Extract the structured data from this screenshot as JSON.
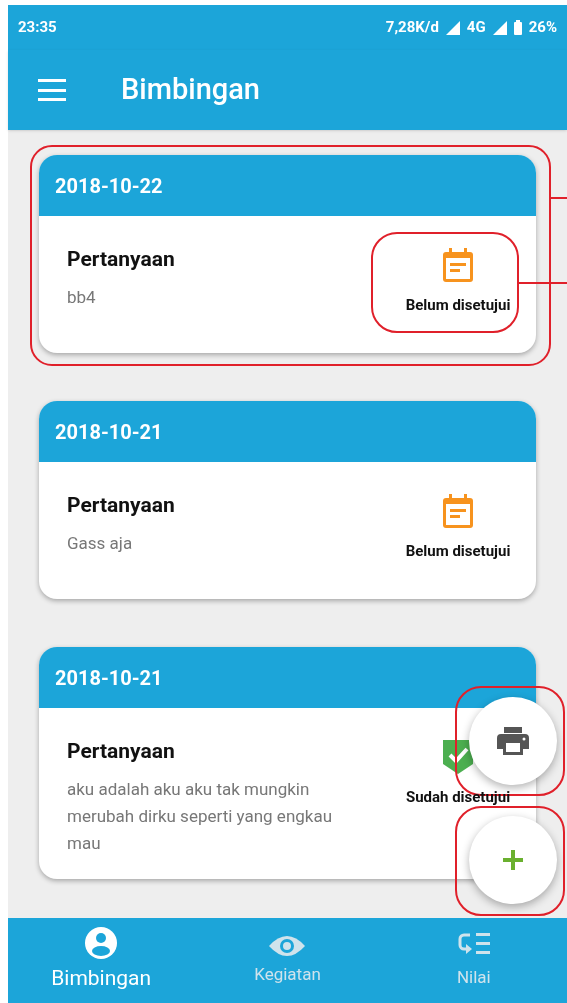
{
  "status_bar": {
    "time": "23:35",
    "speed": "7,28K/d",
    "network": "4G",
    "battery": "26%"
  },
  "app_bar": {
    "title": "Bimbingan"
  },
  "cards": [
    {
      "date": "2018-10-22",
      "title": "Pertanyaan",
      "text": "bb4",
      "status": {
        "kind": "pending",
        "label": "Belum disetujui"
      }
    },
    {
      "date": "2018-10-21",
      "title": "Pertanyaan",
      "text": "Gass aja",
      "status": {
        "kind": "pending",
        "label": "Belum disetujui"
      }
    },
    {
      "date": "2018-10-21",
      "title": "Pertanyaan",
      "text": "aku adalah aku aku tak mungkin merubah dirku seperti yang engkau mau",
      "status": {
        "kind": "approved",
        "label": "Sudah disetujui"
      }
    }
  ],
  "fabs": [
    {
      "kind": "print"
    },
    {
      "kind": "add"
    }
  ],
  "bottom_nav": [
    {
      "kind": "person",
      "label": "Bimbingan",
      "selected": true
    },
    {
      "kind": "eye",
      "label": "Kegiatan",
      "selected": false
    },
    {
      "kind": "list",
      "label": "Nilai",
      "selected": false
    }
  ]
}
